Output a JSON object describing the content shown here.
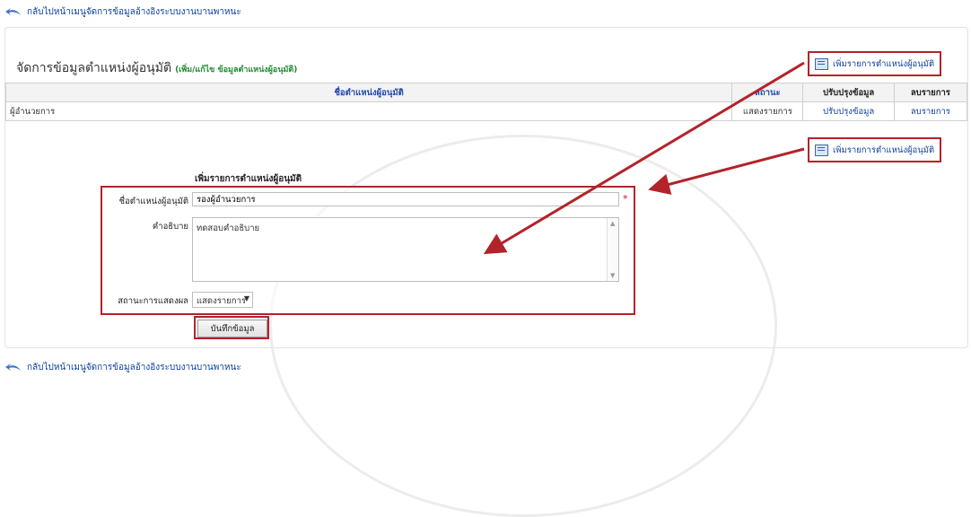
{
  "back_link": {
    "text": "กลับไปหน้าเมนูจัดการข้อมูลอ้างอิงระบบงานบานพาหนะ"
  },
  "page": {
    "title": "จัดการข้อมูลตำแหน่งผู้อนุมัติ",
    "subtitle": "(เพิ่ม/แก้ไข ข้อมูลตำแหน่งผู้อนุมัติ)",
    "add_button_label": "เพิ่มรายการตำแหน่งผู้อนุมัติ"
  },
  "table": {
    "headers": [
      "ชื่อตำแหน่งผู้อนุมัติ",
      "สถานะ",
      "ปรับปรุงข้อมูล",
      "ลบรายการ"
    ],
    "rows": [
      {
        "name": "ผู้อำนวยการ",
        "status": "แสดงรายการ",
        "edit": "ปรับปรุงข้อมูล",
        "delete": "ลบรายการ"
      }
    ]
  },
  "form": {
    "title": "เพิ่มรายการตำแหน่งผู้อนุมัติ",
    "name_label": "ชื่อตำแหน่งผู้อนุมัติ",
    "name_value": "รองผู้อำนวยการ",
    "required_mark": "*",
    "desc_label": "คำอธิบาย",
    "desc_value": "ทดสอบคำอธิบาย",
    "status_label": "สถานะการแสดงผล",
    "status_value": "แสดงรายการ",
    "save_label": "บันทึกข้อมูล"
  },
  "colors": {
    "link": "#0b3f9a",
    "highlight": "#b3232a",
    "subtitle": "#1e8b2e"
  }
}
